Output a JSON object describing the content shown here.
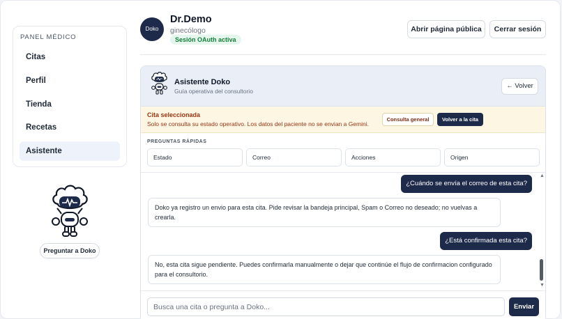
{
  "sidebar": {
    "title": "PANEL MÉDICO",
    "items": [
      {
        "label": "Citas"
      },
      {
        "label": "Perfil"
      },
      {
        "label": "Tienda"
      },
      {
        "label": "Recetas"
      },
      {
        "label": "Asistente",
        "active": true
      }
    ],
    "ask_button": "Preguntar a Doko"
  },
  "header": {
    "avatar_text": "Doko",
    "doctor_name": "Dr.Demo",
    "specialty": "ginecólogo",
    "session_badge": "Sesión OAuth activa",
    "public_page_button": "Abrir página pública",
    "logout_button": "Cerrar sesión"
  },
  "assistant": {
    "title": "Asistente Doko",
    "subtitle": "Guía operativa del consultorio",
    "back_button": "← Volver",
    "selected": {
      "title": "Cita seleccionada",
      "text": "Solo se consulta su estado operativo. Los datos del paciente no se envian a Gemini.",
      "general_button": "Consulta general",
      "return_button": "Volver a la cita"
    },
    "quick_questions_label": "PREGUNTAS RÁPIDAS",
    "quick_questions": [
      "Estado",
      "Correo",
      "Acciones",
      "Origen"
    ],
    "messages": [
      {
        "role": "user",
        "text": "¿Cuándo se envía el correo de esta cita?"
      },
      {
        "role": "assistant",
        "text": "Doko ya registro un envio para esta cita. Pide revisar la bandeja principal, Spam o Correo no deseado; no vuelvas a crearla."
      },
      {
        "role": "user",
        "text": "¿Está confirmada esta cita?"
      },
      {
        "role": "assistant",
        "text": "No, esta cita sigue pendiente. Puedes confirmarla manualmente o dejar que continúe el flujo de confirmacion configurado para el consultorio."
      }
    ],
    "input_placeholder": "Busca una cita o pregunta a Doko...",
    "send_button": "Enviar"
  },
  "colors": {
    "navy": "#1e2a4a",
    "badge_green": "#16803c",
    "warning_bg": "#fdf6e3",
    "warning_text": "#9a3412"
  },
  "icons": {
    "robot": "robot-mascot-icon",
    "scroll_up": "scroll-up-icon",
    "scroll_down": "scroll-down-icon"
  }
}
